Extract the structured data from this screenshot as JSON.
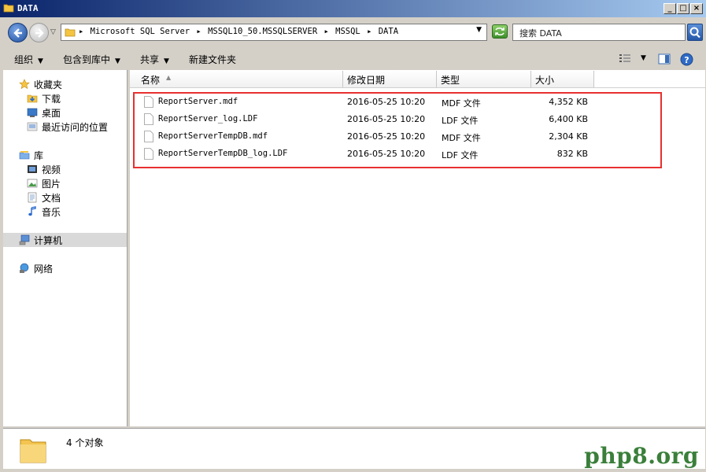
{
  "window": {
    "title": "DATA"
  },
  "address": {
    "crumbs": [
      "Microsoft SQL Server",
      "MSSQL10_50.MSSQLSERVER",
      "MSSQL",
      "DATA"
    ],
    "separator": "▸",
    "search_placeholder": "搜索 DATA"
  },
  "toolbar": {
    "organize": "组织",
    "include_in_library": "包含到库中",
    "share": "共享",
    "new_folder": "新建文件夹"
  },
  "nav": {
    "favorites": "收藏夹",
    "downloads": "下载",
    "desktop": "桌面",
    "recent": "最近访问的位置",
    "libraries": "库",
    "videos": "视频",
    "pictures": "图片",
    "documents": "文档",
    "music": "音乐",
    "computer": "计算机",
    "network": "网络"
  },
  "columns": {
    "name": "名称",
    "date": "修改日期",
    "type": "类型",
    "size": "大小"
  },
  "files": [
    {
      "name": "ReportServer.mdf",
      "date": "2016-05-25 10:20",
      "type": "MDF 文件",
      "size": "4,352 KB"
    },
    {
      "name": "ReportServer_log.LDF",
      "date": "2016-05-25 10:20",
      "type": "LDF 文件",
      "size": "6,400 KB"
    },
    {
      "name": "ReportServerTempDB.mdf",
      "date": "2016-05-25 10:20",
      "type": "MDF 文件",
      "size": "2,304 KB"
    },
    {
      "name": "ReportServerTempDB_log.LDF",
      "date": "2016-05-25 10:20",
      "type": "LDF 文件",
      "size": "832 KB"
    }
  ],
  "status": {
    "count": "4 个对象"
  },
  "watermark": "php8.org",
  "colors": {
    "highlight_box": "#e8302f",
    "title_bar": "#0a246a"
  }
}
